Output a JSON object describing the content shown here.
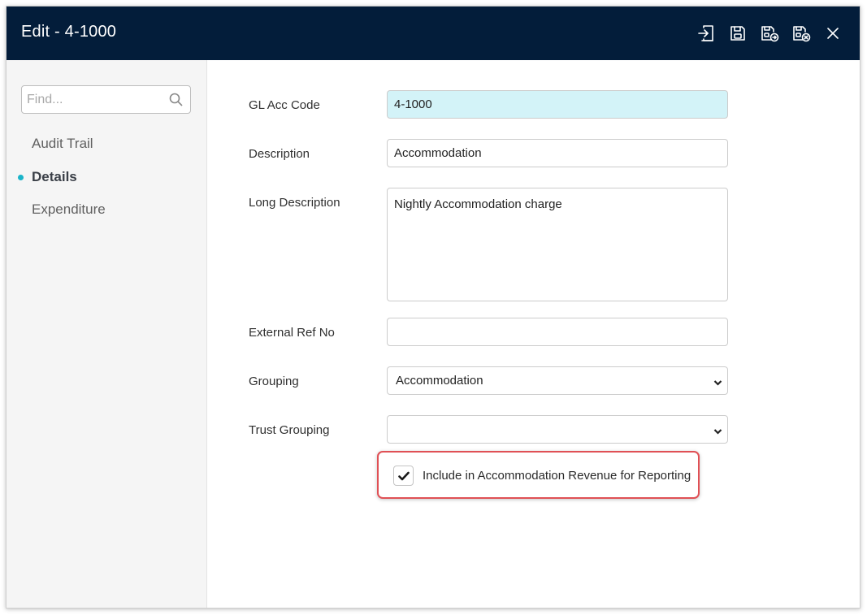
{
  "window": {
    "title": "Edit - 4-1000"
  },
  "toolbar": {
    "icons": [
      "save-and-exit-icon",
      "save-icon",
      "save-as-icon",
      "save-cancel-icon",
      "close-icon"
    ]
  },
  "sidebar": {
    "search_placeholder": "Find...",
    "items": [
      {
        "label": "Audit Trail",
        "active": false
      },
      {
        "label": "Details",
        "active": true
      },
      {
        "label": "Expenditure",
        "active": false
      }
    ]
  },
  "form": {
    "gl_acc_code": {
      "label": "GL Acc Code",
      "value": "4-1000"
    },
    "description": {
      "label": "Description",
      "value": "Accommodation"
    },
    "long_description": {
      "label": "Long Description",
      "value": "Nightly Accommodation charge"
    },
    "external_ref_no": {
      "label": "External Ref No",
      "value": ""
    },
    "grouping": {
      "label": "Grouping",
      "value": "Accommodation"
    },
    "trust_grouping": {
      "label": "Trust Grouping",
      "value": ""
    },
    "include_accommodation": {
      "label": "Include in Accommodation Revenue for Reporting",
      "checked": true
    }
  },
  "colors": {
    "titlebar_bg": "#031d3a",
    "accent_dot": "#1ab4c9",
    "highlight_field": "#d3f3f8",
    "callout_border": "#e05055"
  }
}
